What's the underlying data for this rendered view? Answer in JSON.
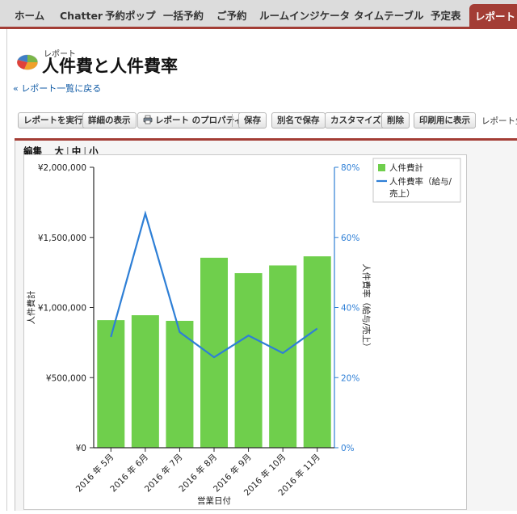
{
  "tabs": [
    {
      "label": "ホーム",
      "active": false
    },
    {
      "label": "Chatter",
      "active": false
    },
    {
      "label": "予約ポップ",
      "active": false
    },
    {
      "label": "一括予約",
      "active": false
    },
    {
      "label": "ご予約",
      "active": false
    },
    {
      "label": "ルームインジケータ",
      "active": false
    },
    {
      "label": "タイムテーブル",
      "active": false
    },
    {
      "label": "予定表",
      "active": false
    },
    {
      "label": "レポート",
      "active": true
    }
  ],
  "header": {
    "subtitle": "レポート",
    "title": "人件費と人件費率",
    "back_link": "« レポート一覧に戻る"
  },
  "toolbar": {
    "buttons": [
      "レポートを実行",
      "詳細の表示",
      "レポート のプロパティ",
      "保存",
      "別名で保存",
      "カスタマイズ",
      "削除",
      "印刷用に表示"
    ],
    "creator_text": "レポート生"
  },
  "chart_links": {
    "edit": "編集",
    "large": "大",
    "medium": "中",
    "small": "小"
  },
  "colors": {
    "bar": "#6fcf4c",
    "line": "#2e7fd6",
    "accent": "#a33d35"
  },
  "chart_data": {
    "type": "bar",
    "categories": [
      "2016 年 5月",
      "2016 年 6月",
      "2016 年 7月",
      "2016 年 8月",
      "2016 年 9月",
      "2016 年 10月",
      "2016 年 11月"
    ],
    "series": [
      {
        "name": "人件費計",
        "type": "bar",
        "axis": "left",
        "values": [
          910000,
          945000,
          905000,
          1355000,
          1245000,
          1300000,
          1365000
        ]
      },
      {
        "name": "人件費率（給与/売上）",
        "type": "line",
        "axis": "right",
        "values": [
          0.316,
          0.668,
          0.33,
          0.258,
          0.32,
          0.27,
          0.34
        ]
      }
    ],
    "xlabel": "営業日付",
    "ylabel": "人件費計",
    "y2label": "人件費率（給与/売上）",
    "ylim": [
      0,
      2000000
    ],
    "y2lim": [
      0,
      0.8
    ],
    "yticks": [
      {
        "value": 0,
        "label": "¥0"
      },
      {
        "value": 500000,
        "label": "¥500,000"
      },
      {
        "value": 1000000,
        "label": "¥1,000,000"
      },
      {
        "value": 1500000,
        "label": "¥1,500,000"
      },
      {
        "value": 2000000,
        "label": "¥2,000,000"
      }
    ],
    "y2ticks": [
      {
        "value": 0,
        "label": "0%"
      },
      {
        "value": 0.2,
        "label": "20%"
      },
      {
        "value": 0.4,
        "label": "40%"
      },
      {
        "value": 0.6,
        "label": "60%"
      },
      {
        "value": 0.8,
        "label": "80%"
      }
    ],
    "legend": {
      "position": "top-right",
      "bar_label": "人件費計",
      "line_label_1": "人件費率（給与/",
      "line_label_2": "売上）"
    },
    "grid": false
  }
}
